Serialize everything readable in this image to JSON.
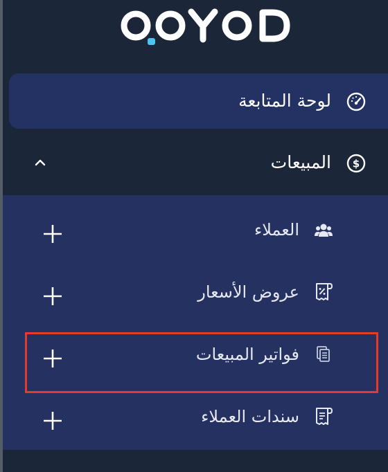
{
  "brand": {
    "logo_text": "OOYOD"
  },
  "nav": {
    "dashboard": "لوحة المتابعة",
    "sales": "المبيعات",
    "sales_submenu": {
      "customers": "العملاء",
      "quotations": "عروض الأسعار",
      "sales_invoices": "فواتير المبيعات",
      "customer_receipts": "سندات العملاء"
    }
  },
  "colors": {
    "sidebar_bg": "#1b2739",
    "active_item_bg": "#233263",
    "submenu_bg": "#243161",
    "highlight_border": "#e63b2b",
    "logo_dot": "#4dc4f0"
  },
  "icons": {
    "dashboard": "speedometer-icon",
    "sales": "dollar-circle-icon",
    "sales_toggle": "chevron-up-icon",
    "customers": "users-icon",
    "quotations": "receipt-percent-icon",
    "sales_invoices": "documents-icon",
    "customer_receipts": "receipt-icon",
    "add": "plus-icon"
  }
}
